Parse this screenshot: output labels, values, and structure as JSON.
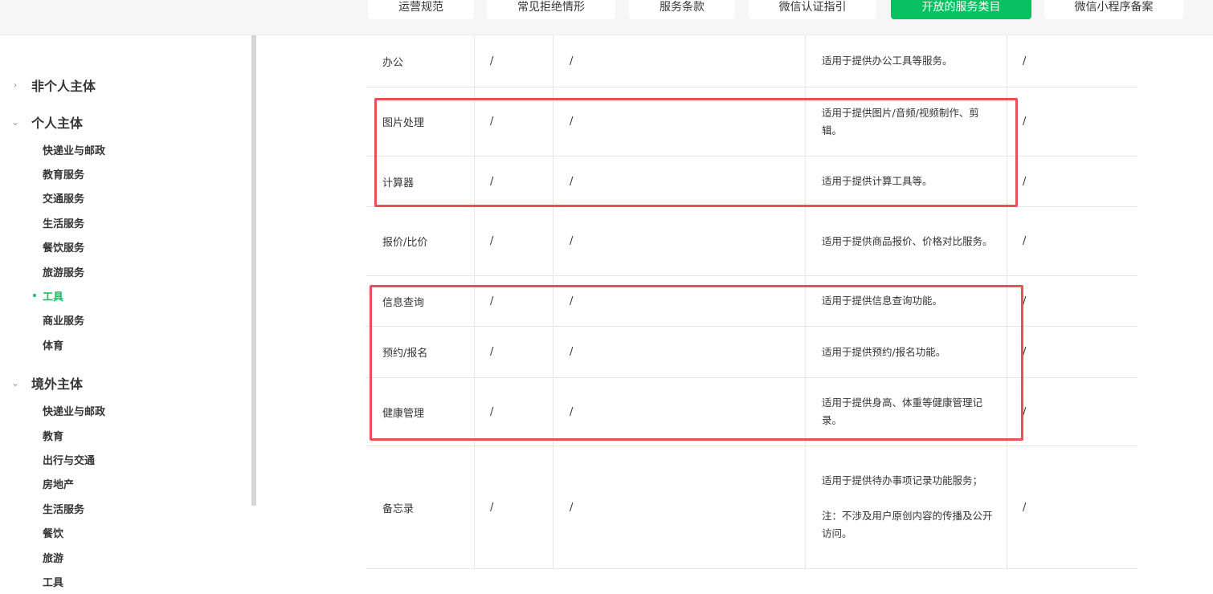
{
  "tabs": [
    {
      "label": "运营规范"
    },
    {
      "label": "常见拒绝情形"
    },
    {
      "label": "服务条款"
    },
    {
      "label": "微信认证指引"
    },
    {
      "label": "开放的服务类目"
    },
    {
      "label": "微信小程序备案"
    }
  ],
  "sidebar": {
    "groups": [
      {
        "label": "非个人主体",
        "chevron": "›",
        "items": []
      },
      {
        "label": "个人主体",
        "chevron": "⌄",
        "items": [
          {
            "label": "快递业与邮政"
          },
          {
            "label": "教育服务"
          },
          {
            "label": "交通服务"
          },
          {
            "label": "生活服务"
          },
          {
            "label": "餐饮服务"
          },
          {
            "label": "旅游服务"
          },
          {
            "label": "工具"
          },
          {
            "label": "商业服务"
          },
          {
            "label": "体育"
          }
        ]
      },
      {
        "label": "境外主体",
        "chevron": "⌄",
        "items": [
          {
            "label": "快递业与邮政"
          },
          {
            "label": "教育"
          },
          {
            "label": "出行与交通"
          },
          {
            "label": "房地产"
          },
          {
            "label": "生活服务"
          },
          {
            "label": "餐饮"
          },
          {
            "label": "旅游"
          },
          {
            "label": "工具"
          }
        ]
      }
    ]
  },
  "table": {
    "rows": [
      {
        "name": "办公",
        "c2": "/",
        "c3": "/",
        "desc": "适用于提供办公工具等服务。",
        "c5": "/"
      },
      {
        "name": "图片处理",
        "c2": "/",
        "c3": "/",
        "desc": "适用于提供图片/音频/视频制作、剪辑。",
        "c5": "/"
      },
      {
        "name": "计算器",
        "c2": "/",
        "c3": "/",
        "desc": "适用于提供计算工具等。",
        "c5": "/"
      },
      {
        "name": "报价/比价",
        "c2": "/",
        "c3": "/",
        "desc": "适用于提供商品报价、价格对比服务。",
        "c5": "/"
      },
      {
        "name": "信息查询",
        "c2": "/",
        "c3": "/",
        "desc": "适用于提供信息查询功能。",
        "c5": "/"
      },
      {
        "name": "预约/报名",
        "c2": "/",
        "c3": "/",
        "desc": "适用于提供预约/报名功能。",
        "c5": "/"
      },
      {
        "name": "健康管理",
        "c2": "/",
        "c3": "/",
        "desc": "适用于提供身高、体重等健康管理记录。",
        "c5": "/"
      },
      {
        "name": "备忘录",
        "c2": "/",
        "c3": "/",
        "desc": "适用于提供待办事项记录功能服务；",
        "desc2": "注：不涉及用户原创内容的传播及公开访问。",
        "c5": "/"
      }
    ]
  },
  "colors": {
    "accent": "#07c160",
    "highlight": "#e8505b"
  }
}
